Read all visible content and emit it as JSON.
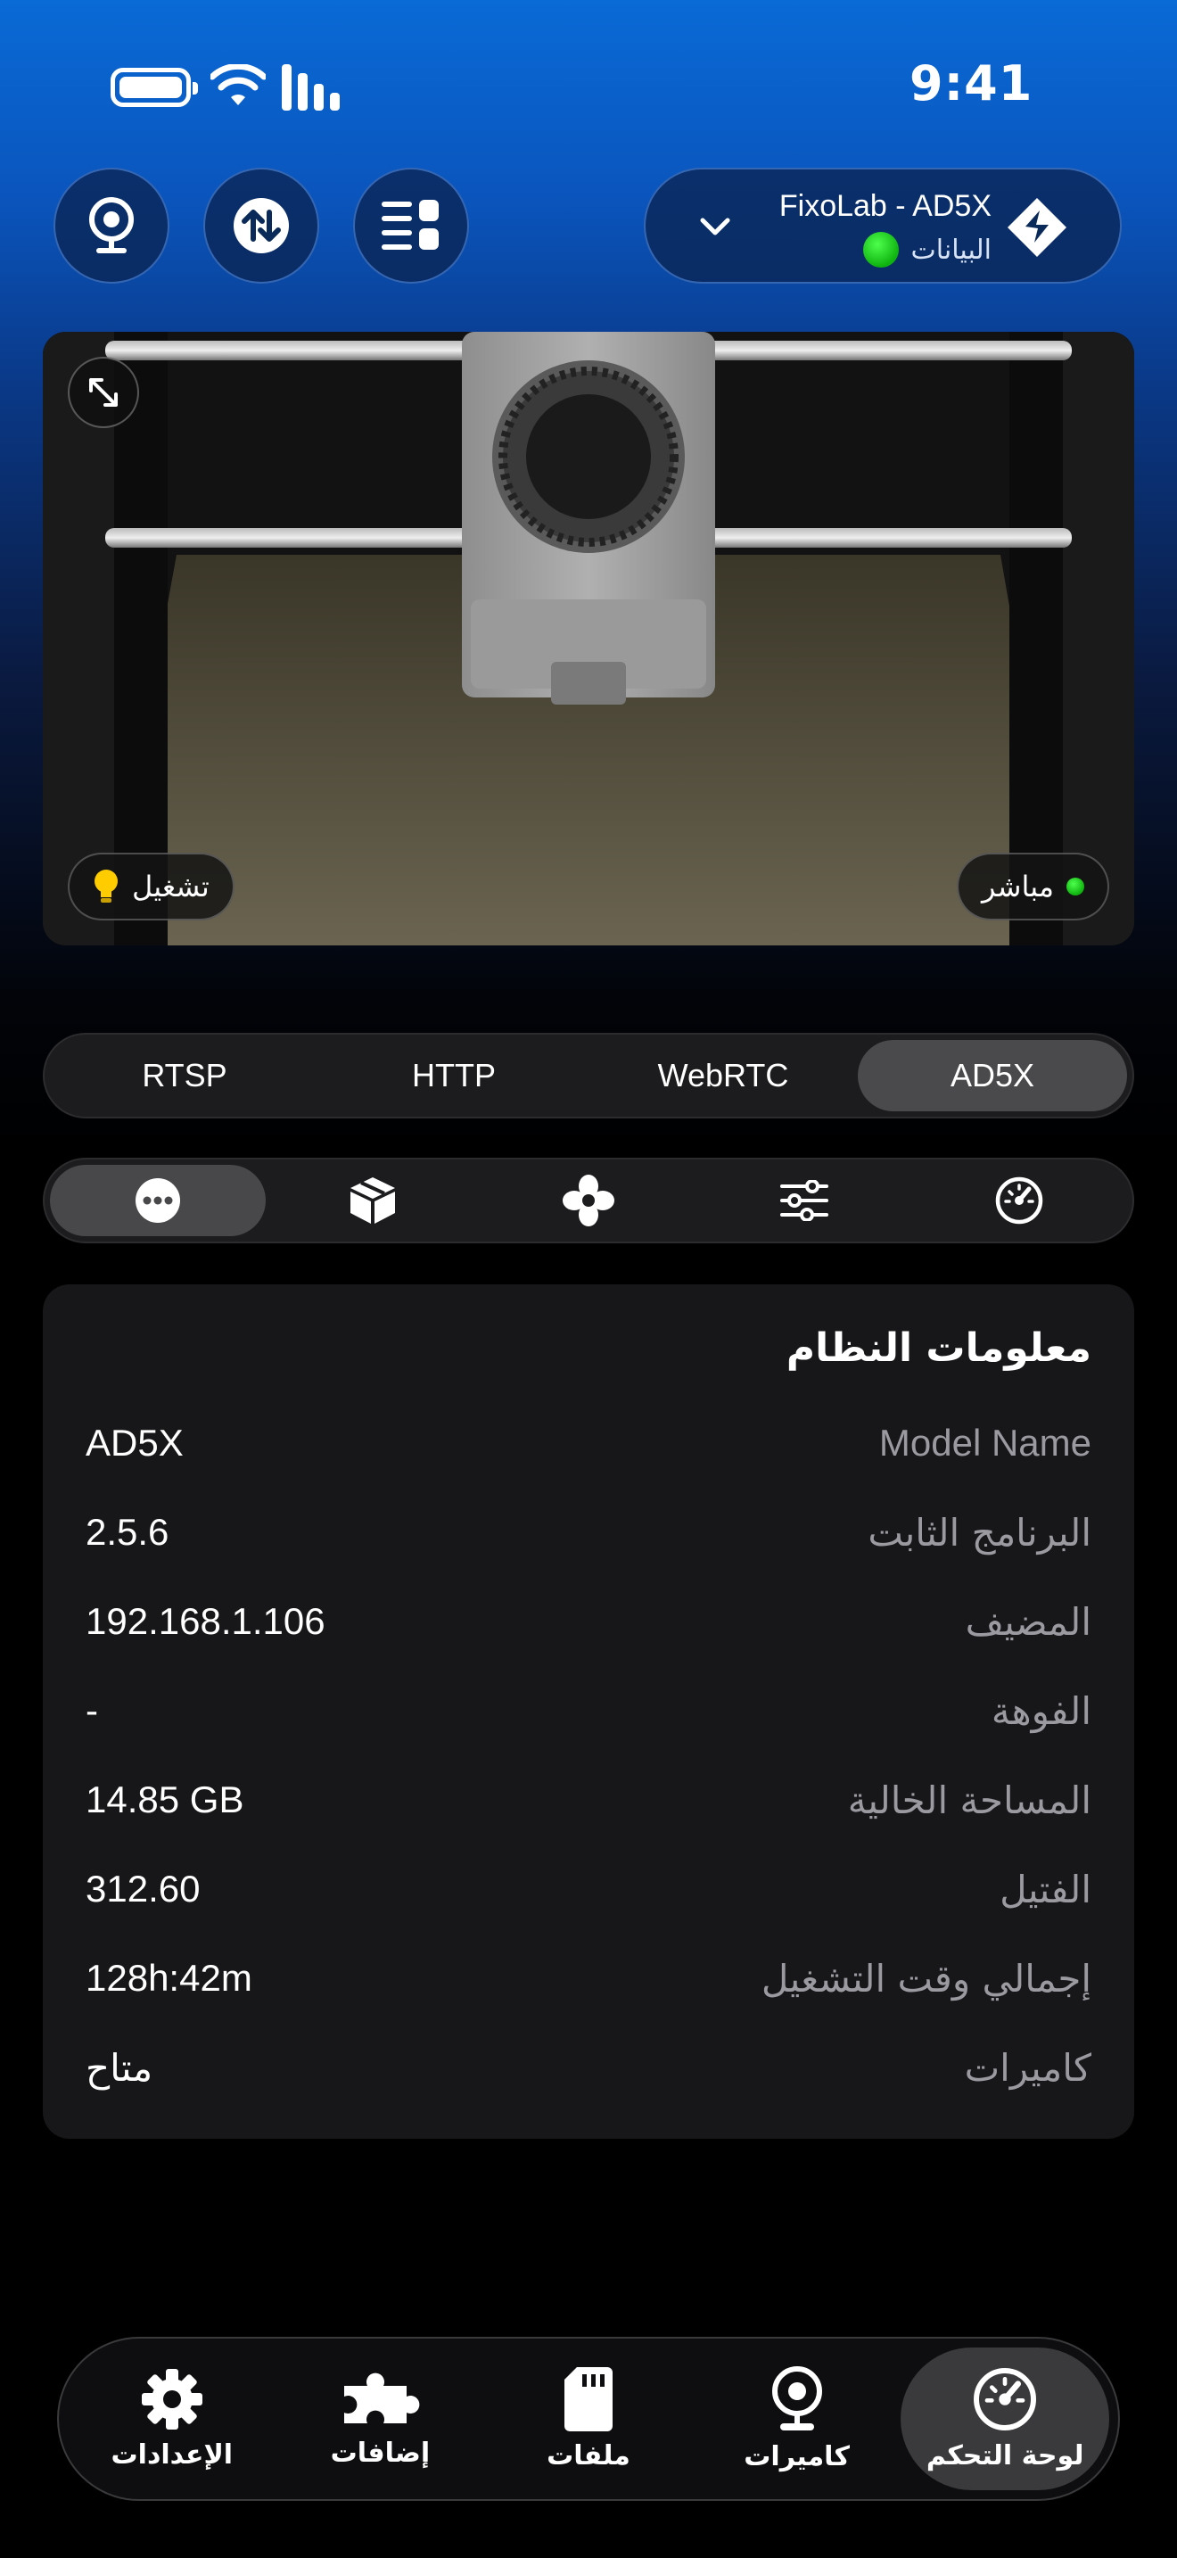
{
  "status_bar": {
    "time": "9:41"
  },
  "header": {
    "printer_name": "FixoLab - AD5X",
    "printer_status": "البيانات",
    "buttons": [
      "webcam-icon",
      "transfer-icon",
      "layout-icon"
    ]
  },
  "camera": {
    "live_label": "مباشر",
    "light_label": "تشغيل"
  },
  "source_tabs": {
    "items": [
      "RTSP",
      "HTTP",
      "WebRTC",
      "AD5X"
    ],
    "selected": "AD5X"
  },
  "control_tabs": {
    "icons": [
      "more-icon",
      "box-icon",
      "fan-icon",
      "sliders-icon",
      "gauge-icon"
    ],
    "selected": "more-icon"
  },
  "system_info": {
    "title": "معلومات النظام",
    "rows": [
      {
        "label": "Model Name",
        "value": "AD5X"
      },
      {
        "label": "البرنامج الثابت",
        "value": "2.5.6"
      },
      {
        "label": "المضيف",
        "value": "192.168.1.106"
      },
      {
        "label": "الفوهة",
        "value": "-"
      },
      {
        "label": "المساحة الخالية",
        "value": "14.85 GB"
      },
      {
        "label": "الفتيل",
        "value": "312.60"
      },
      {
        "label": "إجمالي وقت التشغيل",
        "value": "128h:42m"
      },
      {
        "label": "كاميرات",
        "value": "متاح"
      }
    ]
  },
  "bottom_nav": {
    "items": [
      {
        "label": "الإعدادات",
        "icon": "gear-icon"
      },
      {
        "label": "إضافات",
        "icon": "puzzle-icon"
      },
      {
        "label": "ملفات",
        "icon": "sdcard-icon"
      },
      {
        "label": "كاميرات",
        "icon": "webcam-icon"
      },
      {
        "label": "لوحة التحكم",
        "icon": "gauge-icon"
      }
    ],
    "selected": "لوحة التحكم"
  },
  "colors": {
    "accent": "#0a6ad6",
    "online": "#1ec71e",
    "bulb": "#ffcc00"
  }
}
